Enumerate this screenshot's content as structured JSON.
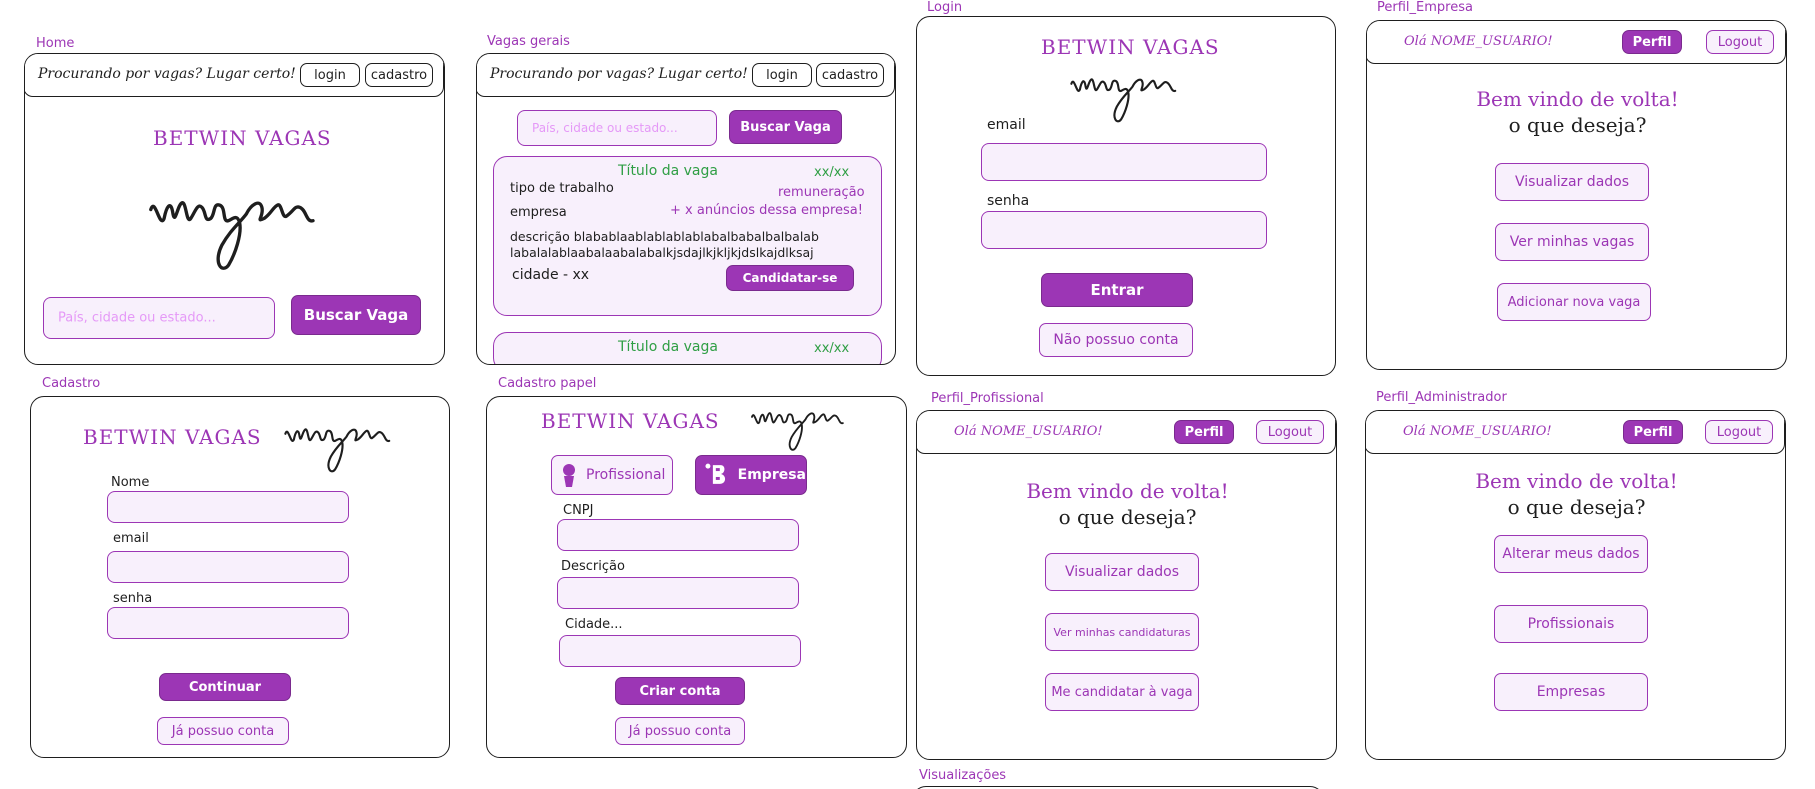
{
  "colors": {
    "accent": "#9c36b5",
    "accent_light": "#f8f0fc",
    "placeholder": "#e599f7",
    "green": "#2f9e44",
    "ink": "#1e1e1e"
  },
  "common": {
    "brand": "BETWIN VAGAS",
    "image_placeholder": "imagem",
    "tagline": "Procurando por vagas? Lugar certo!",
    "login": "login",
    "cadastro": "cadastro",
    "search_placeholder": "País, cidade ou estado...",
    "search_button": "Buscar Vaga",
    "greeting": "Olá NOME_USUARIO!",
    "perfil": "Perfil",
    "logout": "Logout",
    "welcome_line1": "Bem vindo de volta!",
    "welcome_line2": "o que deseja?",
    "already_account": "Já possuo conta"
  },
  "frames": {
    "home": {
      "label": "Home"
    },
    "vagas": {
      "label": "Vagas gerais",
      "job": {
        "title": "Título da vaga",
        "date": "xx/xx",
        "work_type": "tipo de trabalho",
        "pay": "remuneração",
        "company": "empresa",
        "more_ads": "+ x anúncios dessa empresa!",
        "description_1": "descrição blabablaablablablablabalbabalbalbalab",
        "description_2": "labalalablaabalaabalabalkjsdajlkjkljkjdslkajdlksaj",
        "city": "cidade - xx",
        "apply": "Candidatar-se"
      },
      "job2": {
        "title": "Título da vaga",
        "date": "xx/xx"
      }
    },
    "login": {
      "label": "Login",
      "email": "email",
      "senha": "senha",
      "submit": "Entrar",
      "no_account": "Não possuo conta"
    },
    "perfil_empresa": {
      "label": "Perfil_Empresa",
      "options": [
        "Visualizar dados",
        "Ver minhas vagas",
        "Adicionar nova vaga"
      ]
    },
    "cadastro": {
      "label": "Cadastro",
      "nome": "Nome",
      "email": "email",
      "senha": "senha",
      "submit": "Continuar"
    },
    "cadastro_papel": {
      "label": "Cadastro papel",
      "role_profissional": "Profissional",
      "role_empresa": "Empresa",
      "cnpj": "CNPJ",
      "descricao": "Descrição",
      "cidade": "Cidade...",
      "submit": "Criar conta"
    },
    "perfil_profissional": {
      "label": "Perfil_Profissional",
      "options": [
        "Visualizar dados",
        "Ver minhas candidaturas",
        "Me candidatar à vaga"
      ]
    },
    "perfil_admin": {
      "label": "Perfil_Administrador",
      "options": [
        "Alterar meus dados",
        "Profissionais",
        "Empresas"
      ]
    },
    "visualizacoes": {
      "label": "Visualizações"
    }
  }
}
